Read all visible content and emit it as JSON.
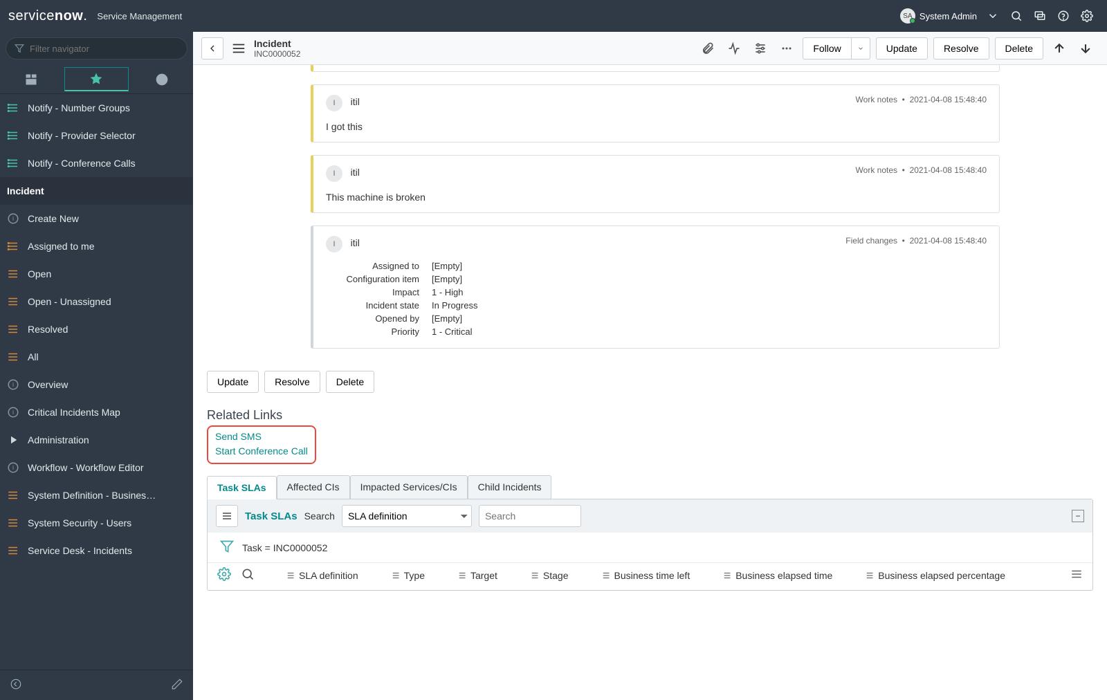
{
  "header": {
    "product": "servicenow",
    "service": "Service Management",
    "user_initials": "SA",
    "user_name": "System Admin"
  },
  "nav": {
    "filter_placeholder": "Filter navigator",
    "top_items": [
      "Notify - Number Groups",
      "Notify - Provider Selector",
      "Notify - Conference Calls"
    ],
    "section": "Incident",
    "inc_items": [
      "Create New",
      "Assigned to me",
      "Open",
      "Open - Unassigned",
      "Resolved",
      "All",
      "Overview",
      "Critical Incidents Map",
      "Administration",
      "Workflow - Workflow Editor",
      "System Definition - Business Ru…",
      "System Security - Users",
      "Service Desk - Incidents"
    ]
  },
  "form": {
    "type": "Incident",
    "number": "INC0000052",
    "follow": "Follow",
    "update": "Update",
    "resolve": "Resolve",
    "delete": "Delete"
  },
  "activity": [
    {
      "initial": "I",
      "author": "itil",
      "type": "Work notes",
      "ts": "2021-04-08 15:48:40",
      "body": "I got this",
      "kind": "worknote"
    },
    {
      "initial": "I",
      "author": "itil",
      "type": "Work notes",
      "ts": "2021-04-08 15:48:40",
      "body": "This machine is broken",
      "kind": "worknote"
    },
    {
      "initial": "I",
      "author": "itil",
      "type": "Field changes",
      "ts": "2021-04-08 15:48:40",
      "kind": "field",
      "fields": [
        {
          "label": "Assigned to",
          "value": "[Empty]"
        },
        {
          "label": "Configuration item",
          "value": "[Empty]"
        },
        {
          "label": "Impact",
          "value": "1 - High"
        },
        {
          "label": "Incident state",
          "value": "In Progress"
        },
        {
          "label": "Opened by",
          "value": "[Empty]"
        },
        {
          "label": "Priority",
          "value": "1 - Critical"
        }
      ]
    }
  ],
  "buttons": {
    "update": "Update",
    "resolve": "Resolve",
    "delete": "Delete"
  },
  "related": {
    "heading": "Related Links",
    "links": [
      "Send SMS",
      "Start Conference Call"
    ]
  },
  "tabs": [
    "Task SLAs",
    "Affected CIs",
    "Impacted Services/CIs",
    "Child Incidents"
  ],
  "list": {
    "title": "Task SLAs",
    "search_label": "Search",
    "search_field": "SLA definition",
    "search_placeholder": "Search",
    "breadcrumb": "Task = INC0000052",
    "columns": [
      "SLA definition",
      "Type",
      "Target",
      "Stage",
      "Business time left",
      "Business elapsed time",
      "Business elapsed percentage"
    ]
  }
}
